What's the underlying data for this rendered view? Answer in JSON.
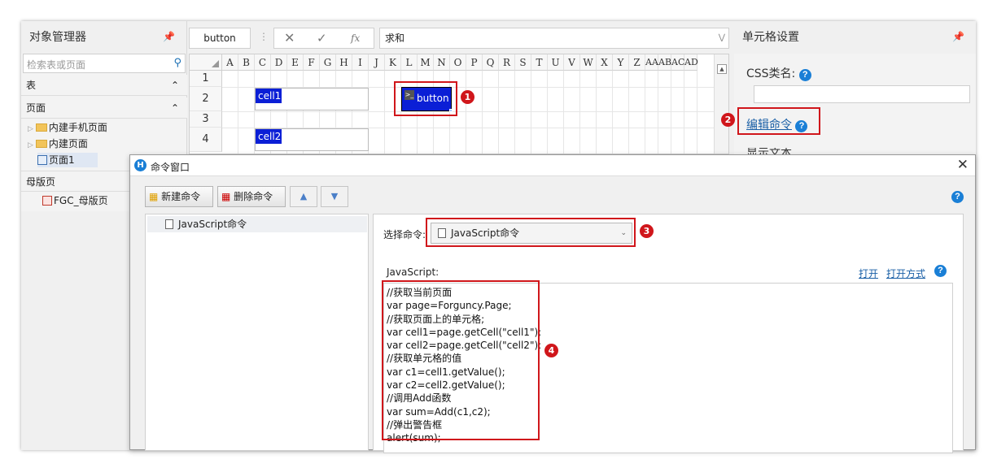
{
  "object_manager": {
    "title": "对象管理器",
    "search_placeholder": "检索表或页面",
    "section_tables": "表",
    "section_pages": "页面",
    "tree": [
      "内建手机页面",
      "内建页面",
      "页面1"
    ],
    "section_master": "母版页",
    "master_item": "FGC_母版页"
  },
  "formula_bar": {
    "name_box": "button",
    "function": "求和",
    "fx_label": "fx"
  },
  "sheet": {
    "columns": [
      "A",
      "B",
      "C",
      "D",
      "E",
      "F",
      "G",
      "H",
      "I",
      "J",
      "K",
      "L",
      "M",
      "N",
      "O",
      "P",
      "Q",
      "R",
      "S",
      "T",
      "U",
      "V",
      "W",
      "X",
      "Y",
      "Z",
      "AA",
      "AB",
      "AC",
      "AD"
    ],
    "rows": [
      "1",
      "2",
      "3",
      "4"
    ],
    "cell1_label": "cell1",
    "cell2_label": "cell2",
    "button_label": "button"
  },
  "cell_settings": {
    "title": "单元格设置",
    "css_label": "CSS类名:",
    "edit_command": "编辑命令",
    "partial_label": "显示文本"
  },
  "badges": [
    "1",
    "2",
    "3",
    "4"
  ],
  "dialog": {
    "title": "命令窗口",
    "new_cmd": "新建命令",
    "delete_cmd": "删除命令",
    "list_item": "JavaScript命令",
    "select_label": "选择命令:",
    "selected_command": "JavaScript命令",
    "js_label": "JavaScript:",
    "open_link": "打开",
    "open_with_link": "打开方式",
    "code_lines": [
      "//获取当前页面",
      "var page=Forguncy.Page;",
      "//获取页面上的单元格;",
      "var cell1=page.getCell(\"cell1\");",
      "var cell2=page.getCell(\"cell2\");",
      "//获取单元格的值",
      "var c1=cell1.getValue();",
      "var c2=cell2.getValue();",
      "//调用Add函数",
      "var sum=Add(c1,c2);",
      "//弹出警告框",
      "alert(sum);"
    ]
  },
  "colors": {
    "accent": "#1a7fd6",
    "highlight": "#d0161b",
    "cell_fill": "#0b1fd6"
  }
}
